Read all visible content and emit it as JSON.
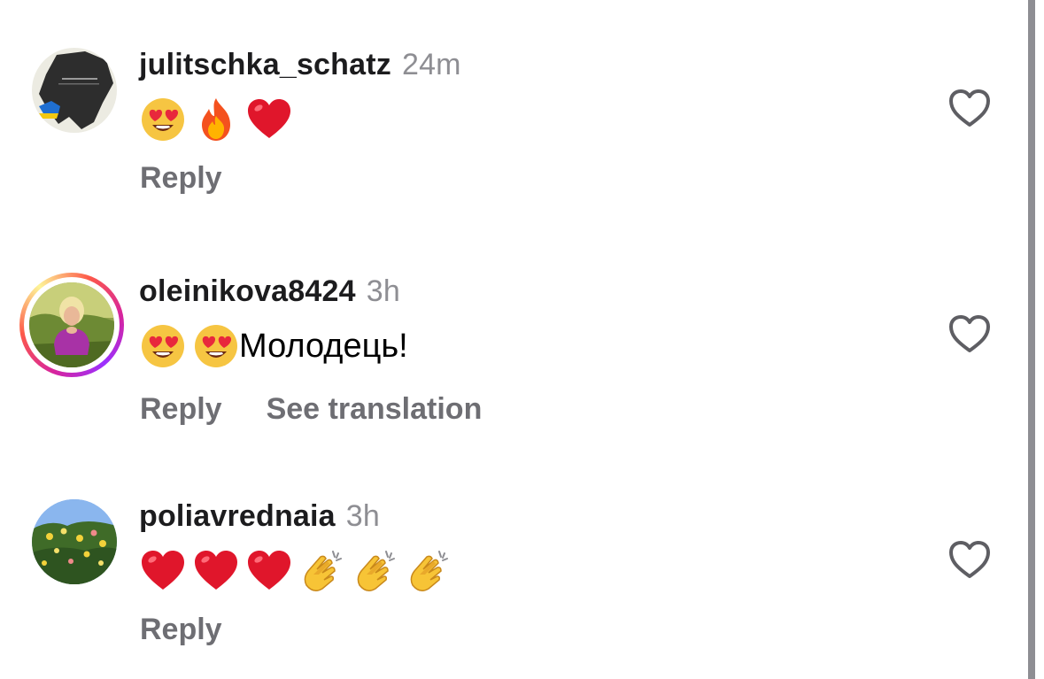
{
  "colors": {
    "text": "#1c1c1e",
    "muted": "#8e8e93",
    "action": "#6e6e73",
    "heart_icon": "#5e5e63",
    "scrollbar": "#8e8e93"
  },
  "comments": [
    {
      "username": "julitschka_schatz",
      "time": "24m",
      "emojis": [
        "heart-eyes-emoji",
        "fire-emoji",
        "red-heart-emoji"
      ],
      "text": "",
      "actions": [
        "Reply"
      ]
    },
    {
      "username": "oleinikova8424",
      "time": "3h",
      "emojis": [
        "heart-eyes-emoji",
        "heart-eyes-emoji"
      ],
      "text": "Молодець!",
      "actions": [
        "Reply",
        "See translation"
      ]
    },
    {
      "username": "poliavrednaia",
      "time": "3h",
      "emojis": [
        "red-heart-emoji",
        "red-heart-emoji",
        "red-heart-emoji",
        "clapping-hands-emoji",
        "clapping-hands-emoji",
        "clapping-hands-emoji"
      ],
      "text": "",
      "actions": [
        "Reply"
      ]
    }
  ]
}
